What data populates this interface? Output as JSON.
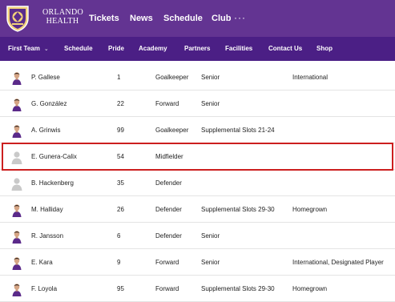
{
  "header": {
    "brand_line1": "ORLANDO",
    "brand_line2": "HEALTH",
    "nav": [
      "Tickets",
      "News",
      "Schedule",
      "Club"
    ],
    "more": "···"
  },
  "subnav": {
    "items": [
      "First Team",
      "Schedule",
      "Pride",
      "Academy",
      "Partners",
      "Facilities",
      "Contact Us",
      "Shop"
    ]
  },
  "colors": {
    "topbar": "#633492",
    "subbar": "#4b1f85",
    "selected_outline": "#cc1f1f"
  },
  "players": [
    {
      "name": "P. Gallese",
      "number": "1",
      "position": "Goalkeeper",
      "roster": "Senior",
      "designation": "International",
      "photo": "player-photo"
    },
    {
      "name": "G. González",
      "number": "22",
      "position": "Forward",
      "roster": "Senior",
      "designation": "",
      "photo": "player-photo"
    },
    {
      "name": "A. Grinwis",
      "number": "99",
      "position": "Goalkeeper",
      "roster": "Supplemental Slots 21-24",
      "designation": "",
      "photo": "player-photo"
    },
    {
      "name": "E. Gunera-Calix",
      "number": "54",
      "position": "Midfielder",
      "roster": "",
      "designation": "",
      "photo": "placeholder"
    },
    {
      "name": "B. Hackenberg",
      "number": "35",
      "position": "Defender",
      "roster": "",
      "designation": "",
      "photo": "placeholder"
    },
    {
      "name": "M. Halliday",
      "number": "26",
      "position": "Defender",
      "roster": "Supplemental Slots 29-30",
      "designation": "Homegrown",
      "photo": "player-photo"
    },
    {
      "name": "R. Jansson",
      "number": "6",
      "position": "Defender",
      "roster": "Senior",
      "designation": "",
      "photo": "player-photo"
    },
    {
      "name": "E. Kara",
      "number": "9",
      "position": "Forward",
      "roster": "Senior",
      "designation": "International, Designated Player",
      "photo": "player-photo"
    },
    {
      "name": "F. Loyola",
      "number": "95",
      "position": "Forward",
      "roster": "Supplemental Slots 29-30",
      "designation": "Homegrown",
      "photo": "player-photo"
    }
  ]
}
